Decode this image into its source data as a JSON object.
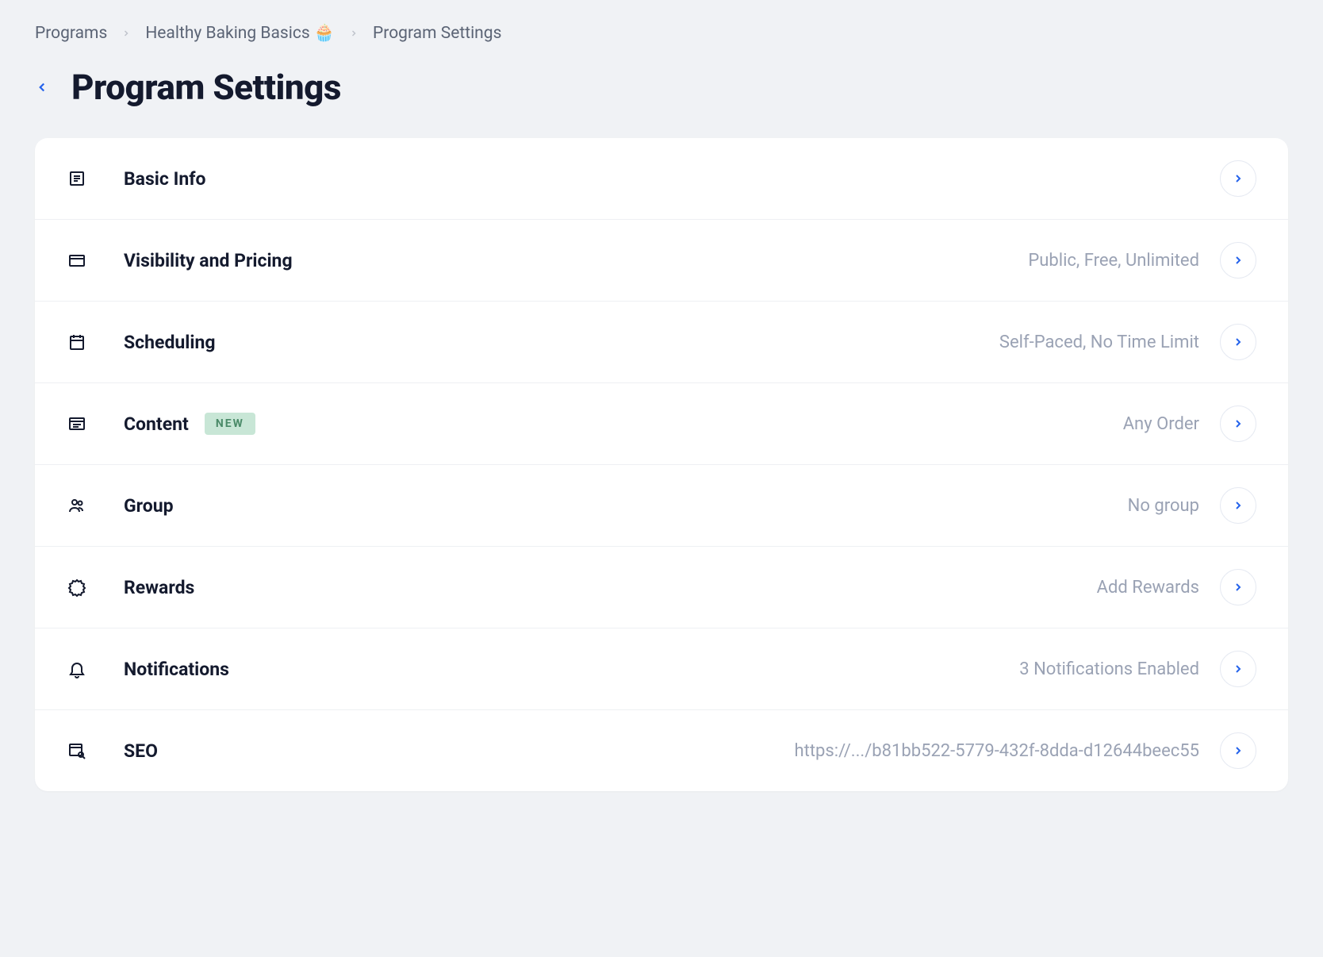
{
  "breadcrumb": {
    "programs": "Programs",
    "program_name": "Healthy Baking Basics 🧁",
    "current": "Program Settings"
  },
  "page_title": "Program Settings",
  "rows": {
    "basic_info": {
      "label": "Basic Info",
      "value": ""
    },
    "visibility": {
      "label": "Visibility and Pricing",
      "value": "Public, Free, Unlimited"
    },
    "scheduling": {
      "label": "Scheduling",
      "value": "Self-Paced, No Time Limit"
    },
    "content": {
      "label": "Content",
      "badge": "NEW",
      "value": "Any Order"
    },
    "group": {
      "label": "Group",
      "value": "No group"
    },
    "rewards": {
      "label": "Rewards",
      "value": "Add Rewards"
    },
    "notifications": {
      "label": "Notifications",
      "value": "3 Notifications Enabled"
    },
    "seo": {
      "label": "SEO",
      "value": "https://.../b81bb522-5779-432f-8dda-d12644beec55"
    }
  }
}
